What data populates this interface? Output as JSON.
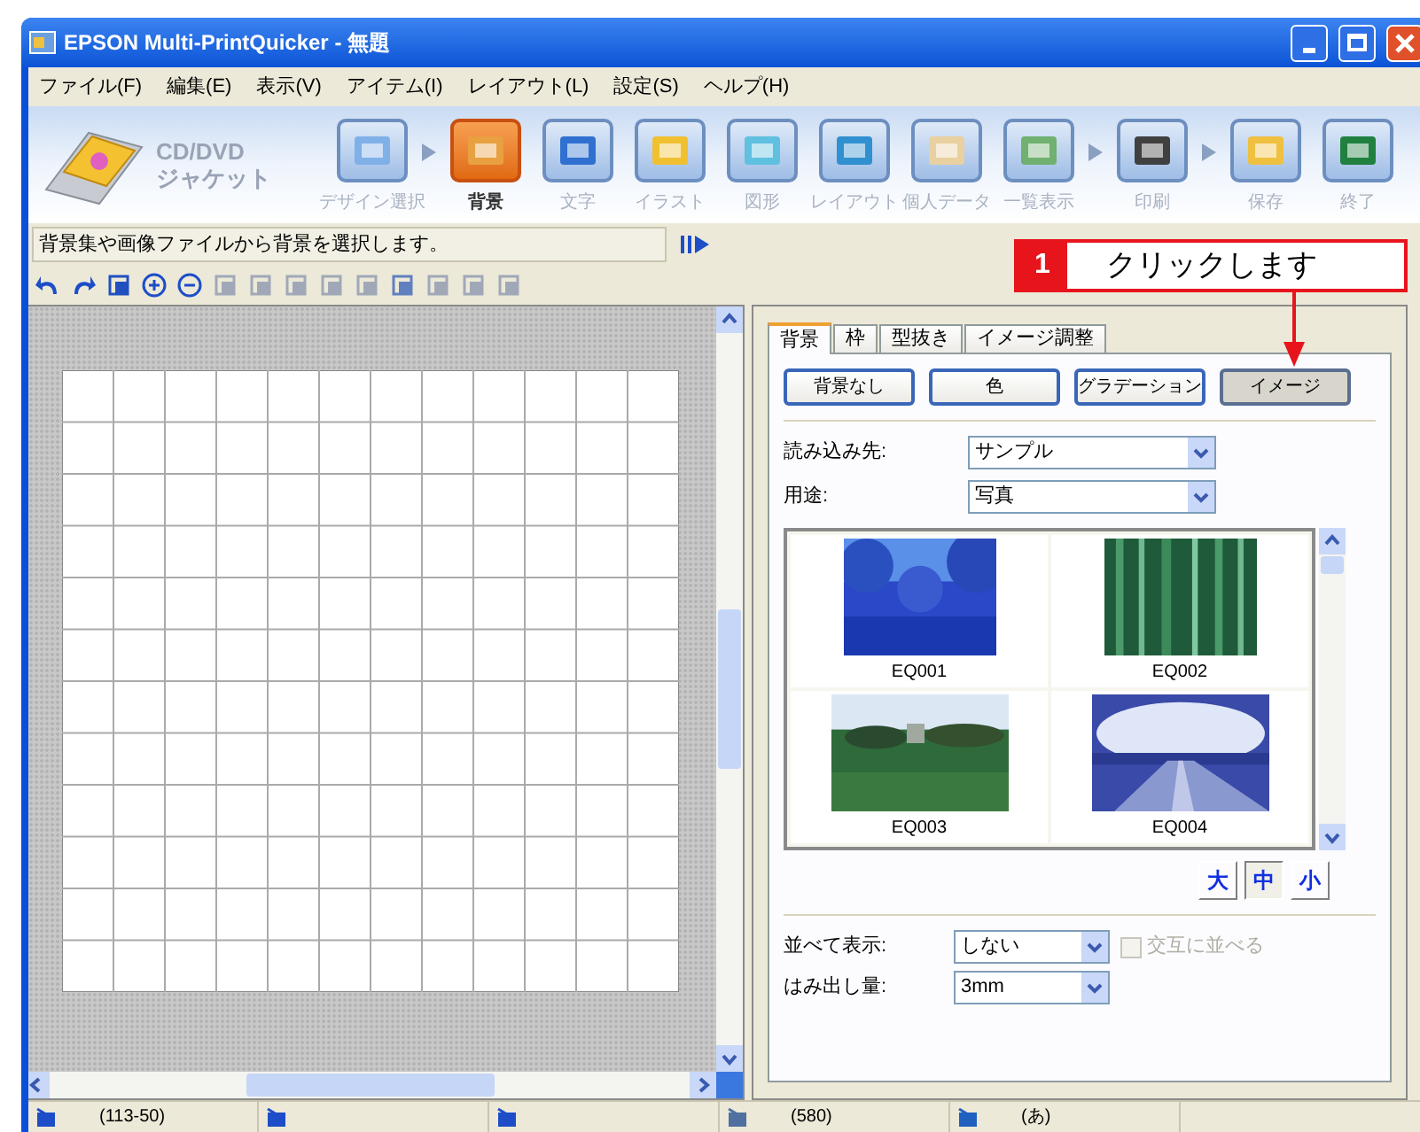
{
  "window": {
    "title": "EPSON Multi-PrintQuicker - 無題"
  },
  "menu": [
    "ファイル(F)",
    "編集(E)",
    "表示(V)",
    "アイテム(I)",
    "レイアウト(L)",
    "設定(S)",
    "ヘルプ(H)"
  ],
  "logo": {
    "line_1": "CD/DVD",
    "line_2": "ジャケット"
  },
  "steps": [
    {
      "label": "デザイン選択",
      "selected": false,
      "arrow_after": true
    },
    {
      "label": "背景",
      "selected": true,
      "arrow_after": false
    },
    {
      "label": "文字",
      "selected": false,
      "arrow_after": false
    },
    {
      "label": "イラスト",
      "selected": false,
      "arrow_after": false
    },
    {
      "label": "図形",
      "selected": false,
      "arrow_after": false
    },
    {
      "label": "レイアウト",
      "selected": false,
      "arrow_after": false
    },
    {
      "label": "個人データ",
      "selected": false,
      "arrow_after": false
    },
    {
      "label": "一覧表示",
      "selected": false,
      "arrow_after": true
    },
    {
      "label": "印刷",
      "selected": false,
      "arrow_after": true
    },
    {
      "label": "保存",
      "selected": false,
      "arrow_after": false
    },
    {
      "label": "終了",
      "selected": false,
      "arrow_after": false
    }
  ],
  "hint_bar": {
    "text": "背景集や画像ファイルから背景を選択します。"
  },
  "callout": {
    "number": "1",
    "text": "クリックします"
  },
  "panel": {
    "tabs": [
      {
        "label": "背景",
        "selected": true
      },
      {
        "label": "枠",
        "selected": false
      },
      {
        "label": "型抜き",
        "selected": false
      },
      {
        "label": "イメージ調整",
        "selected": false
      }
    ],
    "background_buttons": [
      {
        "label": "背景なし",
        "selected": false
      },
      {
        "label": "色",
        "selected": false
      },
      {
        "label": "グラデーション",
        "selected": false
      },
      {
        "label": "イメージ",
        "selected": true
      }
    ],
    "fields": [
      {
        "label": "読み込み先:",
        "value": "サンプル"
      },
      {
        "label": "用途:",
        "value": "写真"
      }
    ],
    "thumbnails": [
      {
        "caption": "EQ001",
        "kind": "picture"
      },
      {
        "caption": "EQ002",
        "kind": "picture"
      },
      {
        "caption": "EQ003",
        "kind": "picture"
      },
      {
        "caption": "EQ004",
        "kind": "picture"
      }
    ],
    "size_buttons": [
      {
        "label": "大",
        "selected": false
      },
      {
        "label": "中",
        "selected": true
      },
      {
        "label": "小",
        "selected": false
      }
    ],
    "tile": {
      "label": "並べて表示:",
      "value": "しない"
    },
    "alternate": {
      "label": "交互に並べる",
      "checked": false,
      "disabled": true
    },
    "bleed": {
      "label": "はみ出し量:",
      "value": "3mm"
    }
  },
  "status_bar": [
    {
      "kind": "reading",
      "text": "(113-50)"
    },
    {
      "kind": "blank"
    },
    {
      "kind": "blank"
    },
    {
      "kind": "reading",
      "text": "(580)"
    },
    {
      "kind": "reading",
      "text": "(あ)"
    }
  ]
}
